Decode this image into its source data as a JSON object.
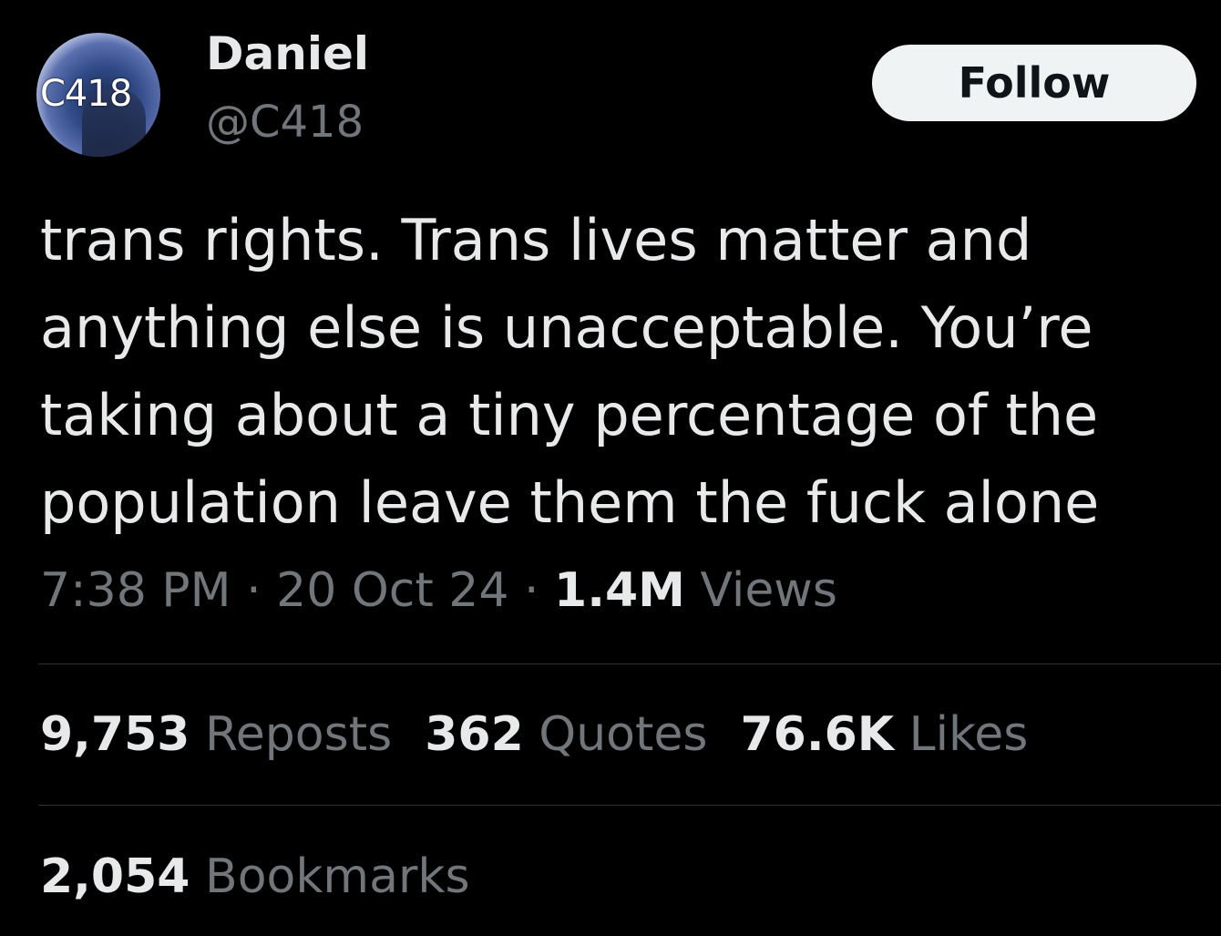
{
  "author": {
    "avatar_text": "C418",
    "name": "Daniel",
    "handle": "@C418"
  },
  "follow_label": "Follow",
  "tweet": {
    "lines": [
      "trans rights. Trans lives matter and",
      "anything else is unacceptable. You’re",
      "taking about a tiny percentage of the",
      "population leave them the fuck alone"
    ],
    "time": "7:38 PM",
    "separator": "·",
    "date": "20 Oct 24",
    "views_count": "1.4M",
    "views_label": "Views"
  },
  "stats": {
    "reposts_count": "9,753",
    "reposts_label": "Reposts",
    "quotes_count": "362",
    "quotes_label": "Quotes",
    "likes_count": "76.6K",
    "likes_label": "Likes",
    "bookmarks_count": "2,054",
    "bookmarks_label": "Bookmarks"
  },
  "colors": {
    "background": "#000000",
    "primary_text": "#e7e9ea",
    "secondary_text": "#71767b",
    "divider": "#2f3336",
    "follow_bg": "#eff3f4"
  }
}
